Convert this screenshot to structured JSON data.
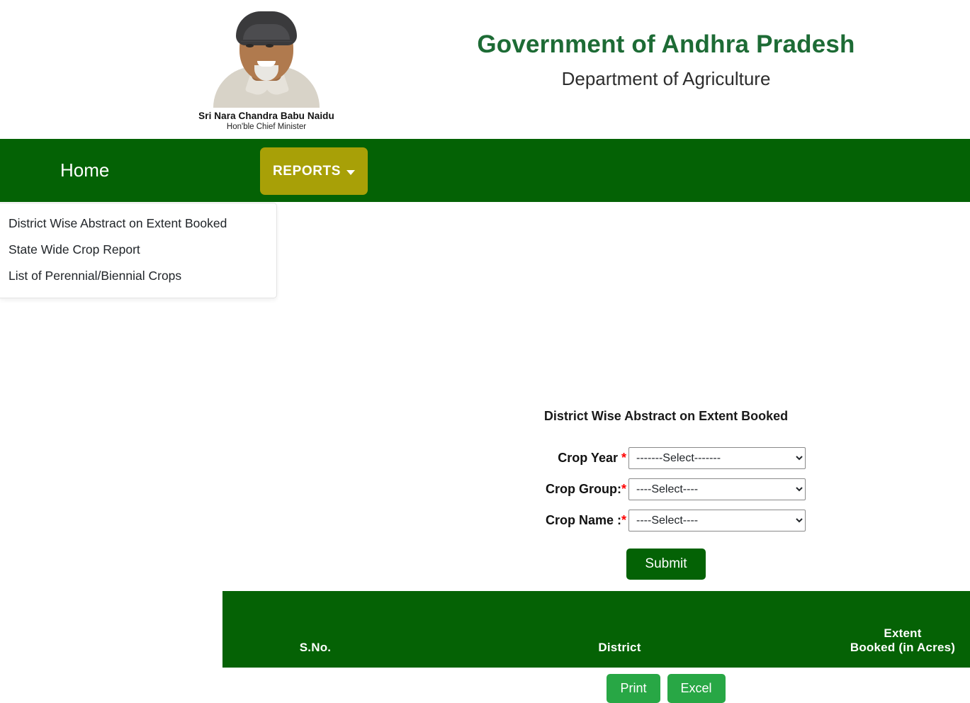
{
  "header": {
    "cm_name": "Sri Nara Chandra Babu Naidu",
    "cm_role": "Hon'ble Chief Minister",
    "gov_title": "Government of Andhra Pradesh",
    "dept_title": "Department of Agriculture",
    "title_color": "#1d6b35"
  },
  "navbar": {
    "background": "#046205",
    "home_label": "Home",
    "reports_label": "REPORTS",
    "reports_color": "#a8a007"
  },
  "dropdown": {
    "items": [
      {
        "label": "District Wise Abstract on Extent Booked"
      },
      {
        "label": "State Wide Crop Report"
      },
      {
        "label": "List of Perennial/Biennial Crops"
      }
    ]
  },
  "form": {
    "title": "District Wise Abstract on Extent Booked",
    "fields": [
      {
        "label": "Crop Year ",
        "required_mark": "*",
        "value": "-------Select-------",
        "options": [
          "-------Select-------"
        ]
      },
      {
        "label": "Crop Group:",
        "required_mark": "*",
        "value": "----Select----",
        "options": [
          "----Select----"
        ]
      },
      {
        "label": "Crop Name :",
        "required_mark": "*",
        "value": "----Select----",
        "options": [
          "----Select----"
        ]
      }
    ],
    "submit_label": "Submit",
    "submit_color": "#046205"
  },
  "table": {
    "header_color": "#056205",
    "columns": [
      {
        "label": "S.No."
      },
      {
        "label": "District"
      },
      {
        "label_line1": "Extent",
        "label_line2": "Booked (in Acres)"
      }
    ],
    "rows": []
  },
  "actions": {
    "print_label": "Print",
    "excel_label": "Excel",
    "button_color": "#28a745"
  }
}
